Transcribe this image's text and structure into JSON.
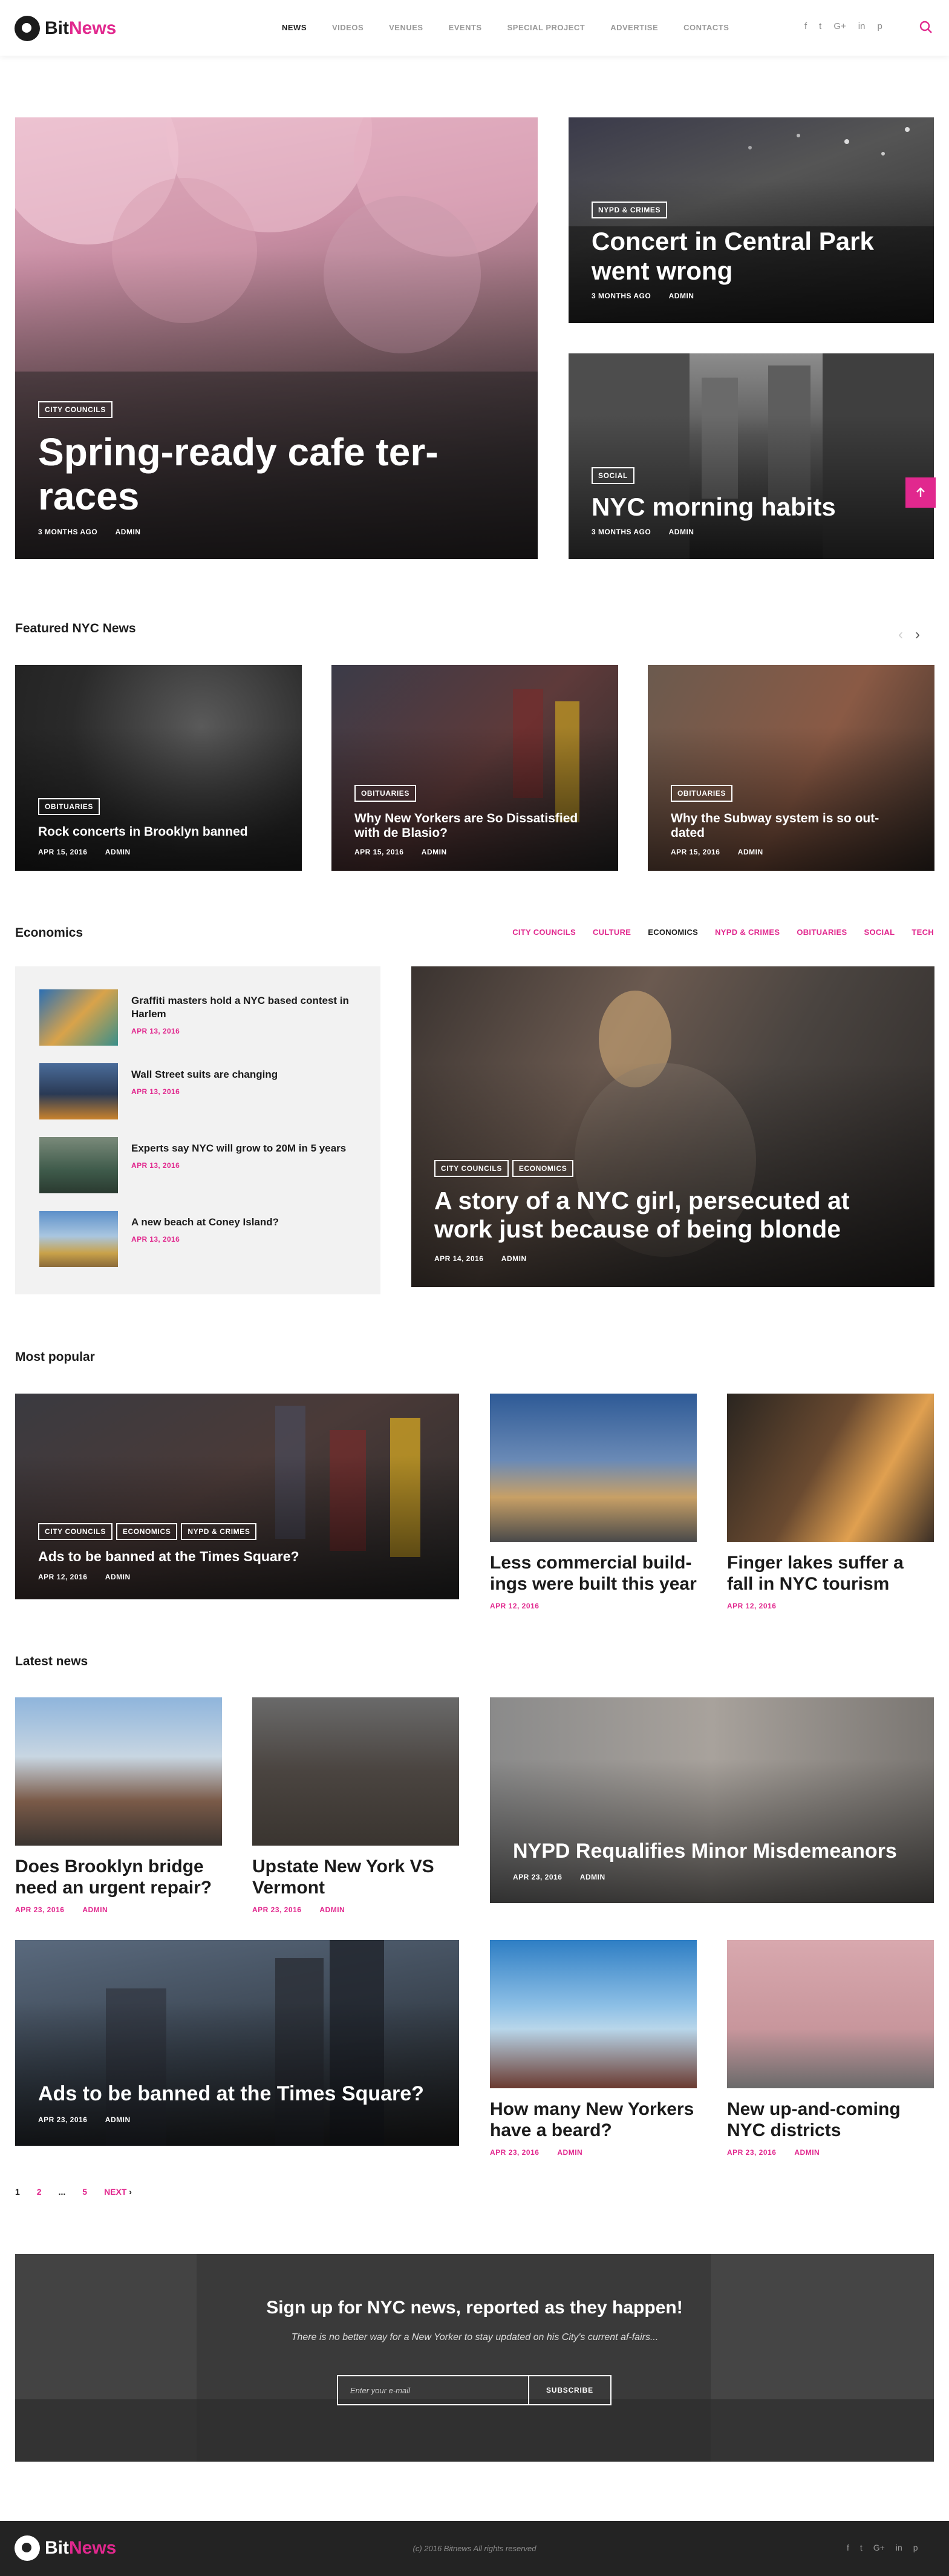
{
  "nav": {
    "logo_part1": "Bit",
    "logo_part2": "News",
    "menu": [
      "NEWS",
      "VIDEOS",
      "VENUES",
      "EVENTS",
      "SPECIAL PROJECT",
      "ADVERTISE",
      "CONTACTS"
    ],
    "active_menu": "NEWS",
    "social": [
      "f",
      "t",
      "G+",
      "in",
      "p"
    ]
  },
  "hero": {
    "main": {
      "tag": "CITY COUNCILS",
      "title": "Spring-ready cafe ter-\nraces",
      "date": "3 MONTHS AGO",
      "author": "ADMIN"
    },
    "top_right": {
      "tag": "NYPD & CRIMES",
      "title": "Concert in Central Park went wrong",
      "date": "3 MONTHS AGO",
      "author": "ADMIN"
    },
    "bottom_right": {
      "tag": "SOCIAL",
      "title": "NYC morning habits",
      "date": "3 MONTHS AGO",
      "author": "ADMIN"
    }
  },
  "featured": {
    "title": "Featured NYC News",
    "items": [
      {
        "tag": "OBITUARIES",
        "title": "Rock concerts in Brooklyn banned",
        "date": "APR 15, 2016",
        "author": "ADMIN"
      },
      {
        "tag": "OBITUARIES",
        "title": "Why New Yorkers are So Dissatisfied with de Blasio?",
        "date": "APR 15, 2016",
        "author": "ADMIN"
      },
      {
        "tag": "OBITUARIES",
        "title": "Why the Subway system is so out-dated",
        "date": "APR 15, 2016",
        "author": "ADMIN"
      }
    ]
  },
  "economics": {
    "title": "Economics",
    "categories": [
      "CITY COUNCILS",
      "CULTURE",
      "ECONOMICS",
      "NYPD & CRIMES",
      "OBITUARIES",
      "SOCIAL",
      "TECH"
    ],
    "active_category": "ECONOMICS",
    "list": [
      {
        "title": "Graffiti masters hold a NYC based contest in Harlem",
        "date": "APR 13, 2016"
      },
      {
        "title": "Wall Street suits are changing",
        "date": "APR 13, 2016"
      },
      {
        "title": "Experts say NYC will grow to 20M in 5 years",
        "date": "APR 13, 2016"
      },
      {
        "title": "A new beach at Coney Island?",
        "date": "APR 13, 2016"
      }
    ],
    "feature": {
      "tags": [
        "CITY COUNCILS",
        "ECONOMICS"
      ],
      "title": "A story of a NYC girl, persecuted at work just because of being blonde",
      "date": "APR 14, 2016",
      "author": "ADMIN"
    }
  },
  "popular": {
    "title": "Most popular",
    "big": {
      "tags": [
        "CITY COUNCILS",
        "ECONOMICS",
        "NYPD & CRIMES"
      ],
      "title": "Ads to be banned at the Times Square?",
      "date": "APR 12, 2016",
      "author": "ADMIN"
    },
    "items": [
      {
        "title": "Less commercial build-ings were built this year",
        "date": "APR 12, 2016"
      },
      {
        "title": "Finger lakes suffer a fall in NYC tourism",
        "date": "APR 12, 2016"
      }
    ]
  },
  "latest": {
    "title": "Latest news",
    "row1": [
      {
        "title": "Does Brooklyn bridge need an urgent repair?",
        "date": "APR 23, 2016",
        "author": "ADMIN"
      },
      {
        "title": "Upstate New York VS Vermont",
        "date": "APR 23, 2016",
        "author": "ADMIN"
      }
    ],
    "wide1": {
      "title": "NYPD Requalifies Minor Misdemeanors",
      "date": "APR 23, 2016",
      "author": "ADMIN"
    },
    "wide2": {
      "title": "Ads to be banned at the Times Square?",
      "date": "APR 23, 2016",
      "author": "ADMIN"
    },
    "row2": [
      {
        "title": "How many New Yorkers have a beard?",
        "date": "APR 23, 2016",
        "author": "ADMIN"
      },
      {
        "title": "New up-and-coming NYC districts",
        "date": "APR 23, 2016",
        "author": "ADMIN"
      }
    ]
  },
  "pagination": {
    "current": "1",
    "pages": [
      "2",
      "5"
    ],
    "dots": "...",
    "next": "NEXT"
  },
  "newsletter": {
    "title": "Sign up for NYC news, reported as they happen!",
    "text": "There is no better way for a New Yorker to stay updated on his City's current af-fairs...",
    "placeholder": "Enter your e-mail",
    "button": "SUBSCRIBE"
  },
  "footer": {
    "copyright": "(c) 2016 Bitnews All rights reserved",
    "social": [
      "f",
      "t",
      "G+",
      "in",
      "p"
    ]
  },
  "colors": {
    "accent": "#e1288e",
    "dark": "#1b1b1b",
    "footer_bg": "#232323"
  }
}
